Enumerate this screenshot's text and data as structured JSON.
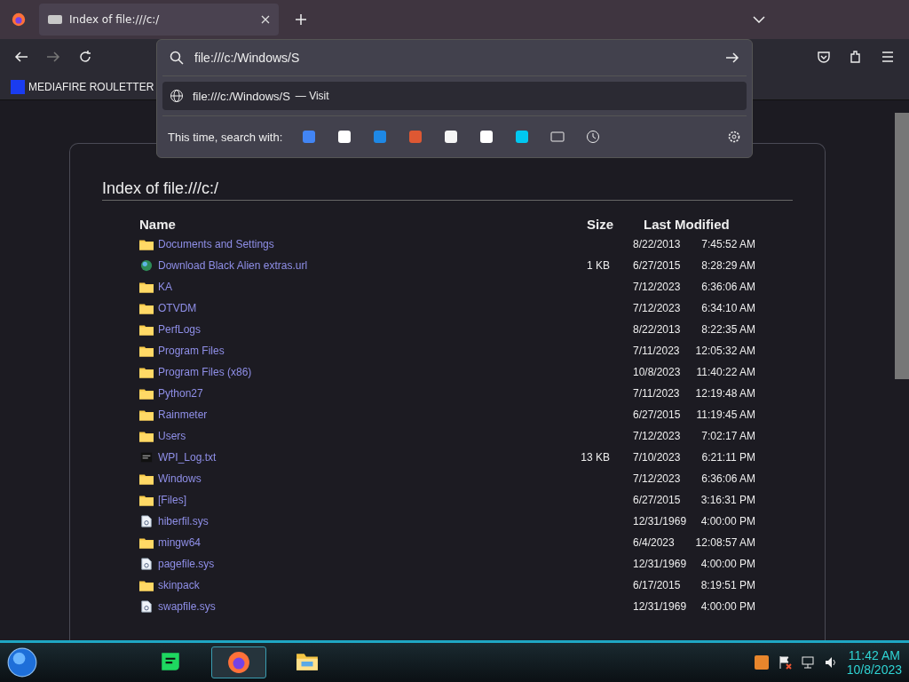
{
  "tab": {
    "title": "Index of file:///c:/",
    "selected": true
  },
  "urlbar": {
    "value": "file:///c:/Windows/S",
    "suggestion": "file:///c:/Windows/S",
    "suggestion_action": "— Visit",
    "search_with": "This time, search with:"
  },
  "bookmarks": [
    {
      "label": "MEDIAFIRE ROULETTER"
    }
  ],
  "page": {
    "title": "Index of file:///c:/",
    "columns": [
      "Name",
      "Size",
      "Last Modified"
    ],
    "rows": [
      {
        "kind": "folder",
        "name": "Documents and Settings",
        "size": "",
        "date": "8/22/2013",
        "time": "7:45:52 AM"
      },
      {
        "kind": "link",
        "name": "Download Black Alien extras.url",
        "size": "1 KB",
        "date": "6/27/2015",
        "time": "8:28:29 AM"
      },
      {
        "kind": "folder",
        "name": "KA",
        "size": "",
        "date": "7/12/2023",
        "time": "6:36:06 AM"
      },
      {
        "kind": "folder",
        "name": "OTVDM",
        "size": "",
        "date": "7/12/2023",
        "time": "6:34:10 AM"
      },
      {
        "kind": "folder",
        "name": "PerfLogs",
        "size": "",
        "date": "8/22/2013",
        "time": "8:22:35 AM"
      },
      {
        "kind": "folder",
        "name": "Program Files",
        "size": "",
        "date": "7/11/2023",
        "time": "12:05:32 AM"
      },
      {
        "kind": "folder",
        "name": "Program Files (x86)",
        "size": "",
        "date": "10/8/2023",
        "time": "11:40:22 AM"
      },
      {
        "kind": "folder",
        "name": "Python27",
        "size": "",
        "date": "7/11/2023",
        "time": "12:19:48 AM"
      },
      {
        "kind": "folder",
        "name": "Rainmeter",
        "size": "",
        "date": "6/27/2015",
        "time": "11:19:45 AM"
      },
      {
        "kind": "folder",
        "name": "Users",
        "size": "",
        "date": "7/12/2023",
        "time": "7:02:17 AM"
      },
      {
        "kind": "text",
        "name": "WPI_Log.txt",
        "size": "13 KB",
        "date": "7/10/2023",
        "time": "6:21:11 PM"
      },
      {
        "kind": "folder",
        "name": "Windows",
        "size": "",
        "date": "7/12/2023",
        "time": "6:36:06 AM"
      },
      {
        "kind": "folder",
        "name": "[Files]",
        "size": "",
        "date": "6/27/2015",
        "time": "3:16:31 PM"
      },
      {
        "kind": "system",
        "name": "hiberfil.sys",
        "size": "",
        "date": "12/31/1969",
        "time": "4:00:00 PM"
      },
      {
        "kind": "folder",
        "name": "mingw64",
        "size": "",
        "date": "6/4/2023",
        "time": "12:08:57 AM"
      },
      {
        "kind": "system",
        "name": "pagefile.sys",
        "size": "",
        "date": "12/31/1969",
        "time": "4:00:00 PM"
      },
      {
        "kind": "folder",
        "name": "skinpack",
        "size": "",
        "date": "6/17/2015",
        "time": "8:19:51 PM"
      },
      {
        "kind": "system",
        "name": "swapfile.sys",
        "size": "",
        "date": "12/31/1969",
        "time": "4:00:00 PM"
      }
    ]
  },
  "taskbar": {
    "apps": [
      {
        "kind": "chat",
        "selected": false
      },
      {
        "kind": "browser",
        "selected": true
      },
      {
        "kind": "files",
        "selected": false
      }
    ],
    "time": "11:42 AM",
    "date": "10/8/2023"
  }
}
